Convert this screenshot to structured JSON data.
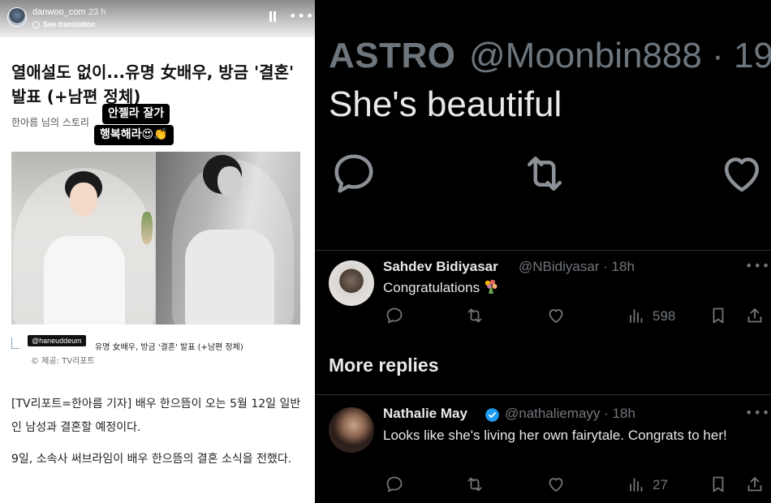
{
  "story": {
    "username": "danwoo_com",
    "time": "23 h",
    "translate": "See translation",
    "headline": "열애설도 없이...유명 女배우, 방금 '결혼' 발표 (+남편 정체)",
    "byline": "한아름 님의 스토리",
    "sticker_line1": "안젤라 잘가",
    "sticker_line2": "행복해라😍👏",
    "caption_tag": "@haneuddeum",
    "caption_text": "유명 女배우, 방금 '결혼' 발표 (+남편 정체)",
    "caption_credit": "© 제공: TV리포트",
    "paragraph1": "[TV리포트=한아름 기자] 배우 한으뜸이 오는 5월 12일 일반인 남성과 결혼할 예정이다.",
    "paragraph2": "9일, 소속사 써브라임이 배우 한으뜸의 결혼 소식을 전했다."
  },
  "thread": {
    "zoom": {
      "name": "ASTRO",
      "handle": "@Moonbin888 · 19",
      "text": "She's beautiful"
    },
    "reply1": {
      "name": "Sahdev Bidiyasar",
      "handle": "@NBidiyasar · 18h",
      "text": "Congratulations",
      "views": "598"
    },
    "more_replies": "More replies",
    "reply2": {
      "name": "Nathalie May",
      "handle": "@nathaliemayy · 18h",
      "text": "Looks like she's living her own fairytale. Congrats to her!",
      "views": "27"
    }
  },
  "colors": {
    "x_text": "#e7e9ea",
    "x_muted": "#71767b",
    "x_divider": "#2f3336",
    "verified": "#1d9bf0"
  }
}
